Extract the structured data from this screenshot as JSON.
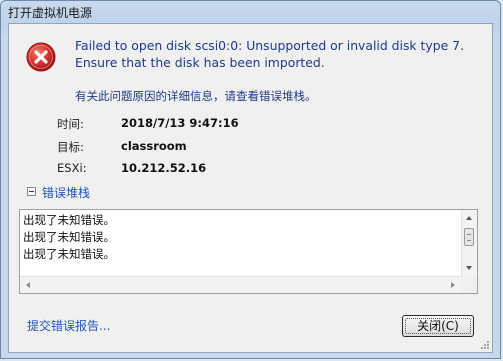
{
  "window": {
    "title": "打开虚拟机电源"
  },
  "error": {
    "line1": "Failed to open disk scsi0:0: Unsupported or invalid disk type 7.",
    "line2": "Ensure that the disk has been imported.",
    "icon": "error-icon",
    "icon_color": "#d32f2f"
  },
  "hint": "有关此问题原因的详细信息，请查看错误堆栈。",
  "details": [
    {
      "label": "时间:",
      "value": "2018/7/13 9:47:16"
    },
    {
      "label": "目标:",
      "value": "classroom"
    },
    {
      "label": "ESXi:",
      "value": "10.212.52.16"
    }
  ],
  "stack": {
    "label": "错误堆栈",
    "lines": [
      "出现了未知错误。",
      "出现了未知错误。",
      "出现了未知错误。"
    ]
  },
  "footer": {
    "report_link": "提交错误报告...",
    "close_label": "关闭(C)"
  },
  "colors": {
    "link": "#2255b8",
    "message": "#1e3a8a"
  }
}
